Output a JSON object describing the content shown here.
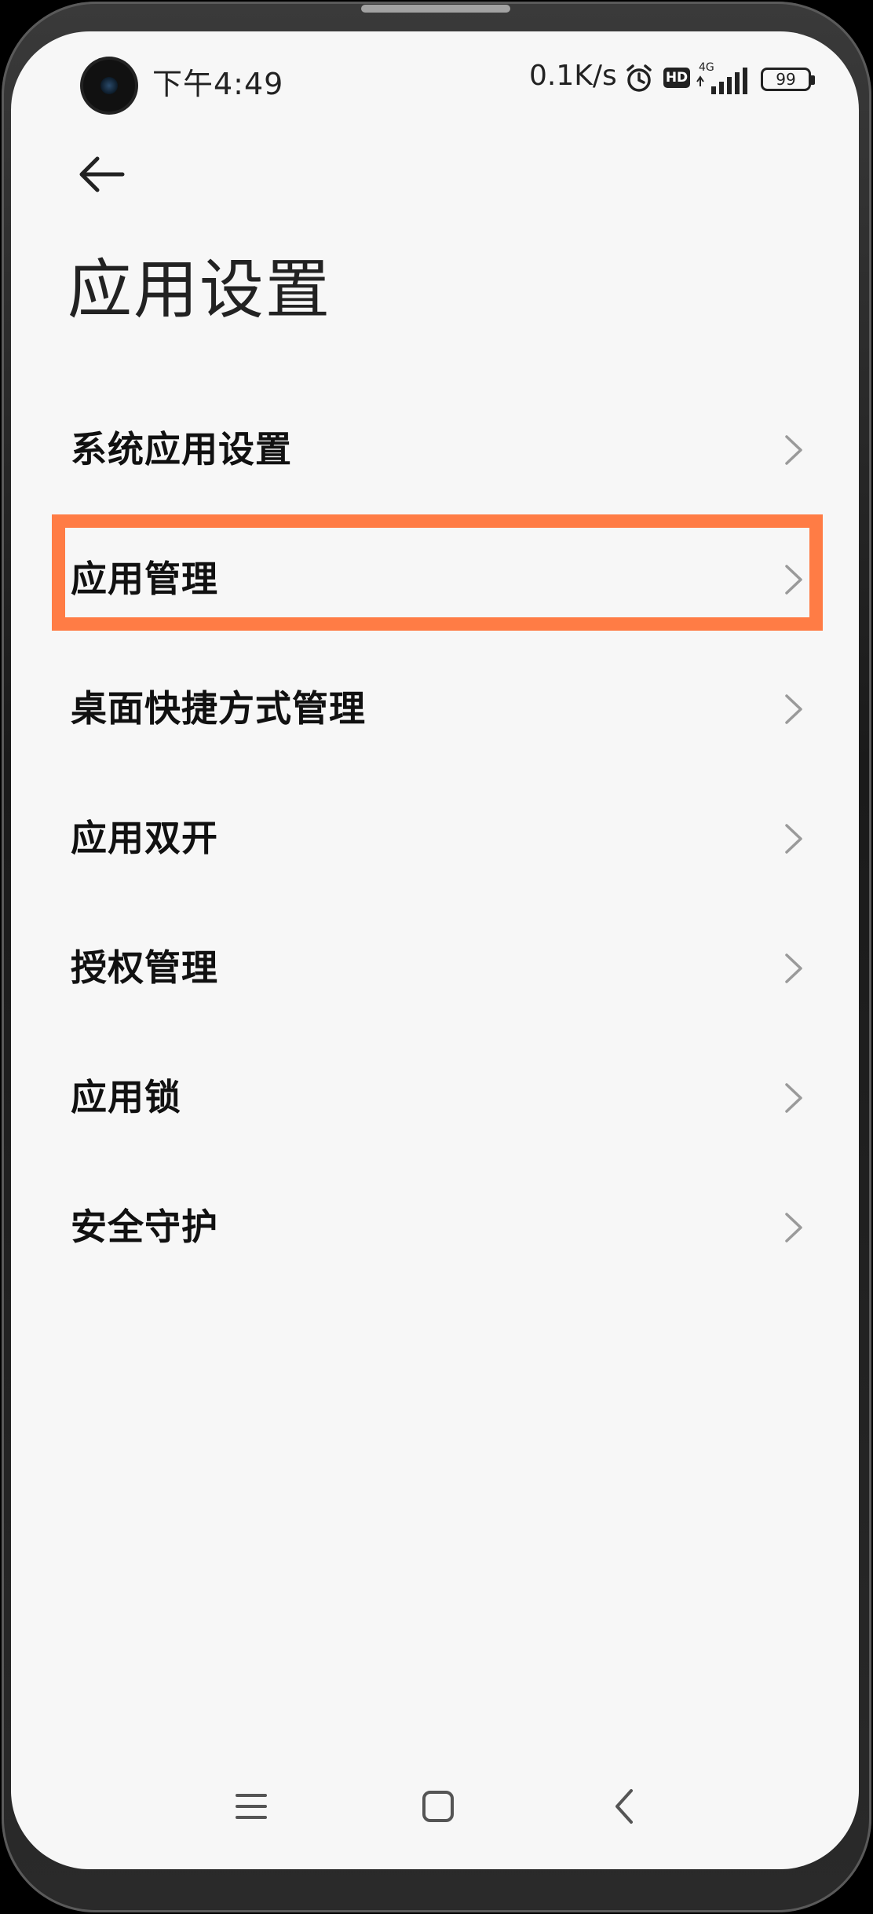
{
  "status_bar": {
    "time": "下午4:49",
    "net_speed": "0.1K/s",
    "hd_label": "HD",
    "network_label": "4G",
    "battery": "99",
    "icons": [
      "alarm-icon",
      "hd-icon",
      "signal-icon",
      "battery-icon"
    ]
  },
  "header": {
    "title": "应用设置",
    "back_icon": "back-arrow-icon"
  },
  "menu": {
    "items": [
      {
        "label": "系统应用设置"
      },
      {
        "label": "应用管理",
        "highlighted": true
      },
      {
        "label": "桌面快捷方式管理"
      },
      {
        "label": "应用双开"
      },
      {
        "label": "授权管理"
      },
      {
        "label": "应用锁"
      },
      {
        "label": "安全守护"
      }
    ],
    "highlight_color": "#ff7c45"
  },
  "nav_bar": {
    "icons": [
      "menu-icon",
      "home-icon",
      "back-icon"
    ]
  }
}
